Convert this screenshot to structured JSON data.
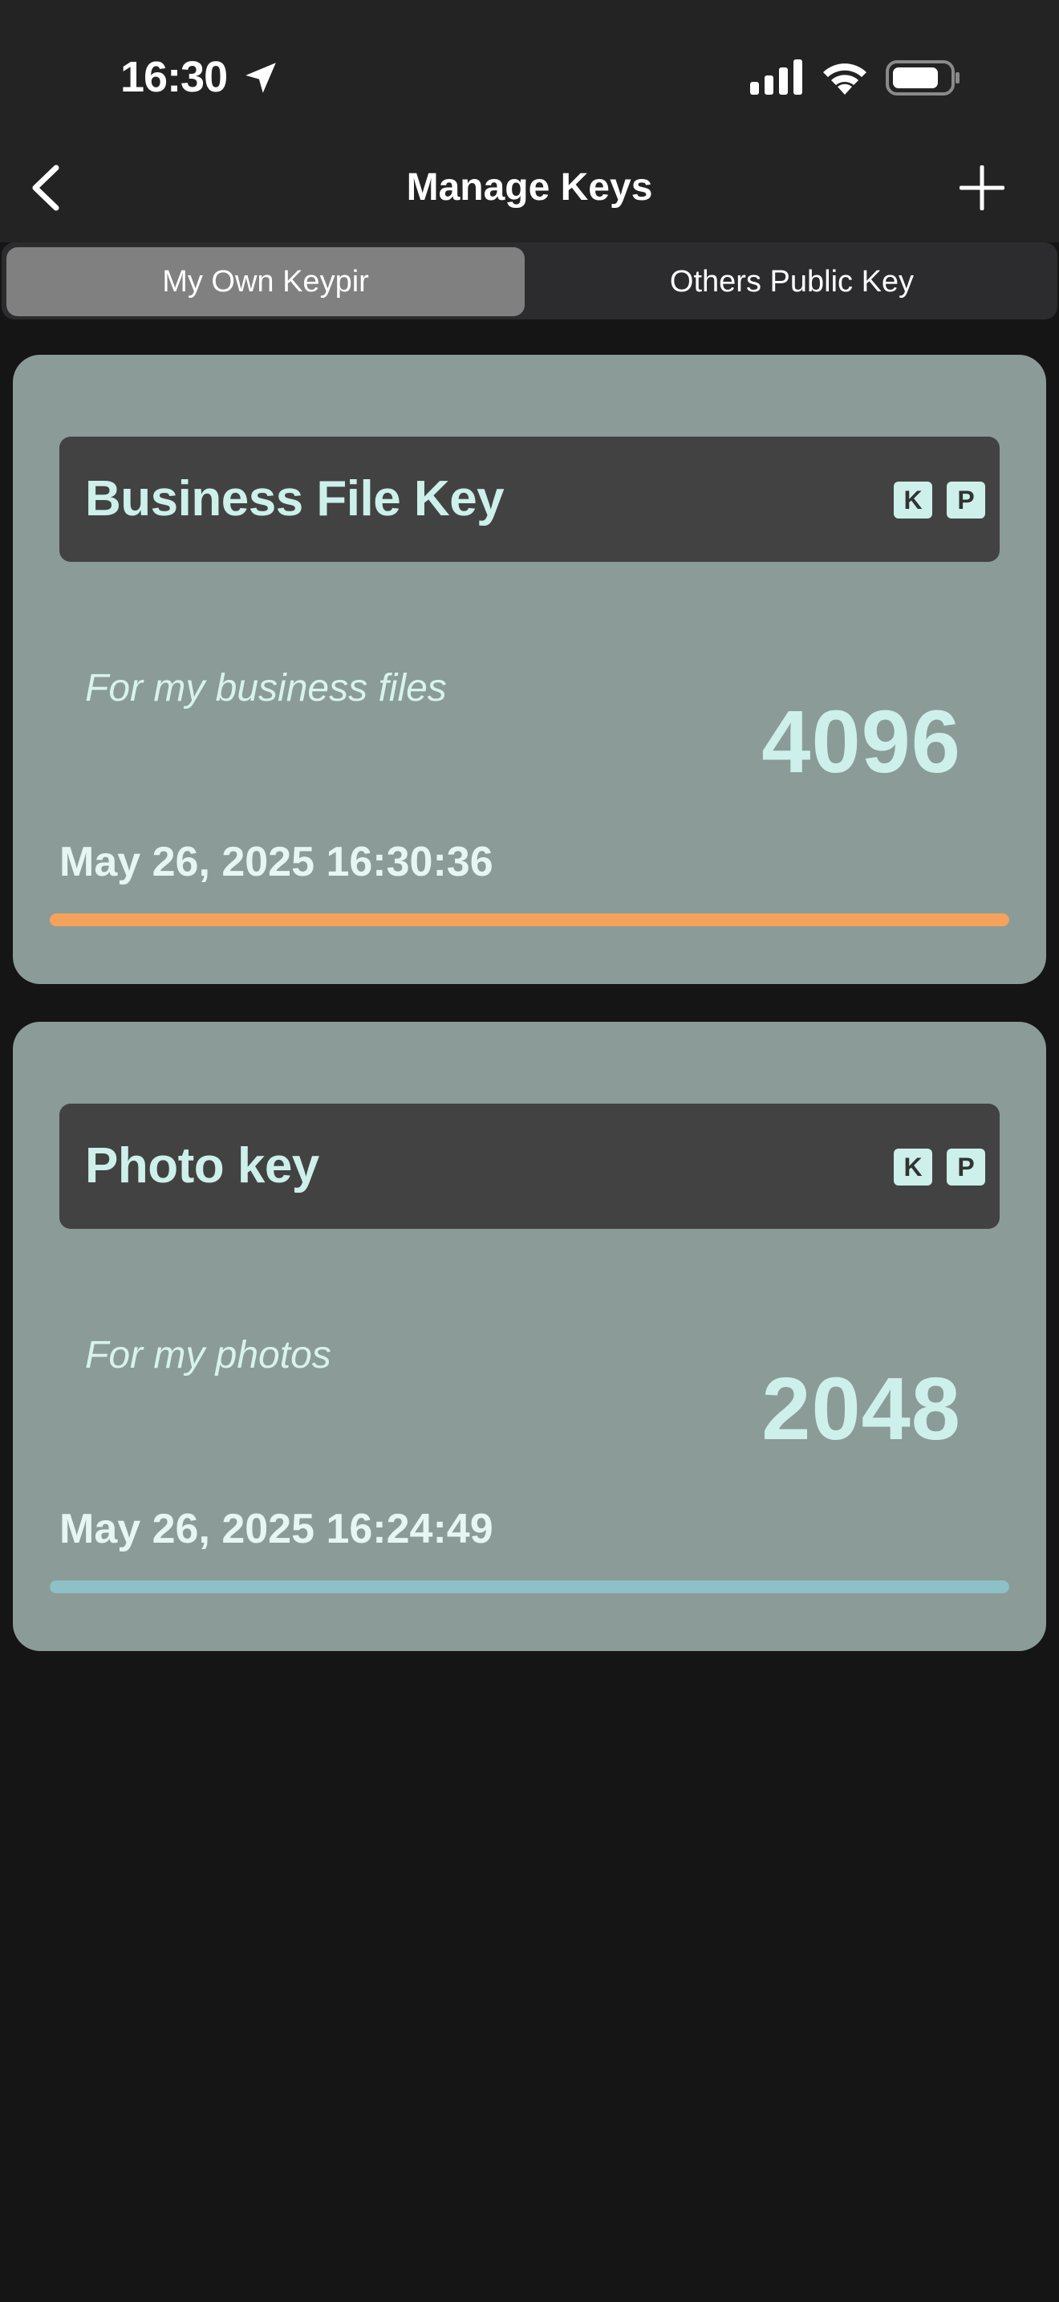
{
  "status_bar": {
    "time": "16:30",
    "icons": [
      "location-arrow-icon",
      "cellular-signal-icon",
      "wifi-icon",
      "battery-icon"
    ]
  },
  "nav": {
    "title": "Manage Keys",
    "back_icon": "chevron-left-icon",
    "add_icon": "plus-icon"
  },
  "tabs": [
    {
      "label": "My Own Keypir",
      "selected": true
    },
    {
      "label": "Others Public Key",
      "selected": false
    }
  ],
  "keys": [
    {
      "name": "Business File Key",
      "badges": [
        "K",
        "P"
      ],
      "description": "For my business files",
      "size": "4096",
      "date": "May 26, 2025 16:30:36",
      "bar_color": "#f5a25d"
    },
    {
      "name": "Photo key",
      "badges": [
        "K",
        "P"
      ],
      "description": "For my photos",
      "size": "2048",
      "date": "May 26, 2025 16:24:49",
      "bar_color": "#8ec0c8"
    }
  ],
  "colors": {
    "background": "#151515",
    "header": "#232323",
    "card": "#8b9b97",
    "card_header": "#424242",
    "accent_text": "#cdf0ea"
  }
}
